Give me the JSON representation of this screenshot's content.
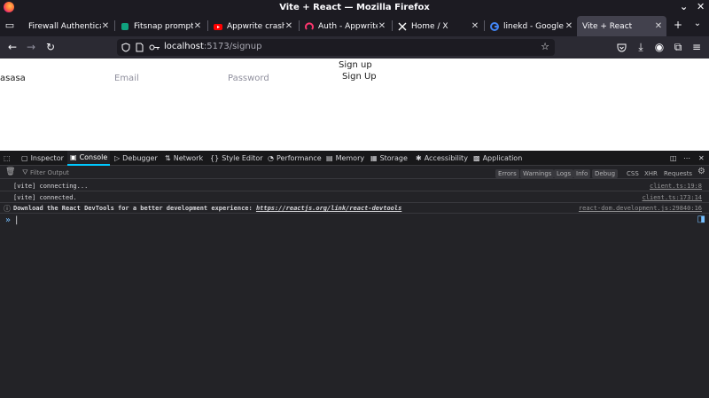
{
  "window": {
    "title": "Vite + React — Mozilla Firefox",
    "minimize": "⌄",
    "close": "✕"
  },
  "tabs": [
    {
      "label": "Firewall Authenticatio",
      "icon": "generic-page-icon",
      "color": "#8f8f9d"
    },
    {
      "label": "Fitsnap prompt",
      "icon": "fitsnap-icon",
      "color": "#10a37f"
    },
    {
      "label": "Appwrite crash cours",
      "icon": "youtube-icon",
      "color": "#ff0000"
    },
    {
      "label": "Auth - Appwrite",
      "icon": "appwrite-icon",
      "color": "#fd366e"
    },
    {
      "label": "Home / X",
      "icon": "x-icon",
      "color": "#ffffff"
    },
    {
      "label": "linekd - Google Searc",
      "icon": "google-icon",
      "color": "#4285f4"
    },
    {
      "label": "Vite + React",
      "icon": "vite-icon",
      "color": "#646cff",
      "active": true
    }
  ],
  "tabbar": {
    "new_tab": "+",
    "list_tabs": "⌄"
  },
  "url": {
    "host": "localhost",
    "path": ":5173/signup"
  },
  "page": {
    "heading": "Sign up",
    "name_value": "asasa",
    "email_placeholder": "Email",
    "password_placeholder": "Password",
    "submit_label": "Sign Up"
  },
  "devtools": {
    "tabs": [
      {
        "label": "Inspector",
        "icon": "inspector-icon"
      },
      {
        "label": "Console",
        "icon": "console-icon",
        "active": true
      },
      {
        "label": "Debugger",
        "icon": "debugger-icon"
      },
      {
        "label": "Network",
        "icon": "network-icon"
      },
      {
        "label": "Style Editor",
        "icon": "style-editor-icon"
      },
      {
        "label": "Performance",
        "icon": "performance-icon"
      },
      {
        "label": "Memory",
        "icon": "memory-icon"
      },
      {
        "label": "Storage",
        "icon": "storage-icon"
      },
      {
        "label": "Accessibility",
        "icon": "accessibility-icon"
      },
      {
        "label": "Application",
        "icon": "application-icon"
      }
    ],
    "filter_placeholder": "Filter Output",
    "filters": [
      "Errors",
      "Warnings",
      "Logs",
      "Info",
      "Debug"
    ],
    "extra_filters": [
      "CSS",
      "XHR",
      "Requests"
    ],
    "logs": [
      {
        "message": "[vite] connecting...",
        "source": "client.ts:19:8"
      },
      {
        "message": "[vite] connected.",
        "source": "client.ts:173:14"
      },
      {
        "message": "Download the React DevTools for a better development experience:",
        "link": "https://reactjs.org/link/react-devtools",
        "source": "react-dom.development.js:29840:16",
        "info": true
      }
    ],
    "prompt": "»",
    "caret": "|"
  }
}
